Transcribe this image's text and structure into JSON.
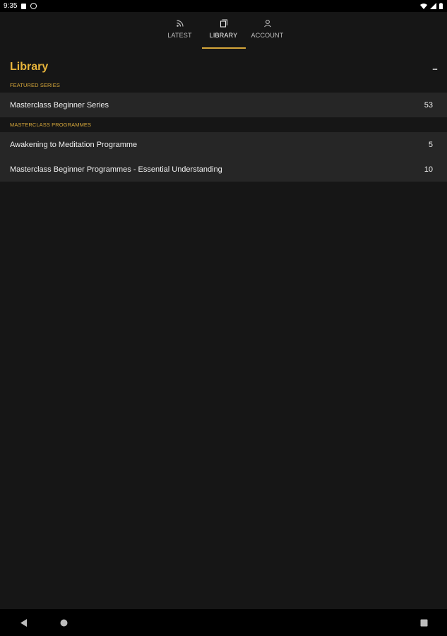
{
  "status_bar": {
    "time": "9:35",
    "left_icons": [
      "sim-card-icon",
      "vpn-icon"
    ],
    "right_icons": [
      "wifi-icon",
      "signal-icon",
      "battery-icon"
    ]
  },
  "tabs": [
    {
      "label": "LATEST",
      "icon": "rss-icon",
      "active": false
    },
    {
      "label": "LIBRARY",
      "icon": "library-icon",
      "active": true
    },
    {
      "label": "ACCOUNT",
      "icon": "account-icon",
      "active": false
    }
  ],
  "page": {
    "title": "Library",
    "more_label": "..."
  },
  "sections": [
    {
      "label": "FEATURED SERIES",
      "items": [
        {
          "title": "Masterclass Beginner Series",
          "count": "53"
        }
      ]
    },
    {
      "label": "MASTERCLASS PROGRAMMES",
      "items": [
        {
          "title": "Awakening to Meditation Programme",
          "count": "5"
        },
        {
          "title": "Masterclass Beginner Programmes - Essential Understanding",
          "count": "10"
        }
      ]
    }
  ],
  "colors": {
    "background": "#161616",
    "accent": "#e8b53b",
    "row": "#262626"
  },
  "nav_bar": [
    "back-icon",
    "home-icon",
    "recents-icon"
  ]
}
